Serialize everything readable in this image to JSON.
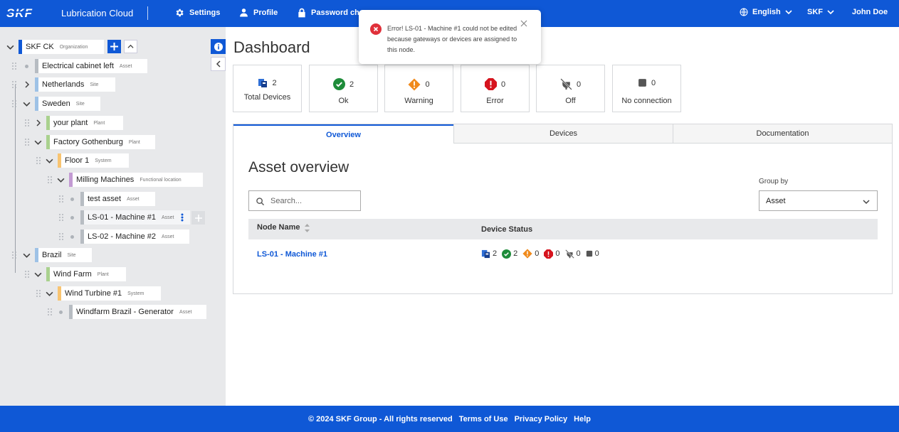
{
  "header": {
    "app_title": "Lubrication Cloud",
    "nav": [
      {
        "label": "Settings",
        "icon": "gear-icon"
      },
      {
        "label": "Profile",
        "icon": "user-icon"
      },
      {
        "label": "Password cha",
        "icon": "lock-icon"
      }
    ],
    "language": "English",
    "org": "SKF",
    "user": "John Doe"
  },
  "toast": {
    "message": "Error! LS-01 - Machine #1 could not be edited because gateways or devices are assigned to this node."
  },
  "tree": [
    {
      "label": "SKF CK",
      "type": "Organization",
      "color": "#0f58d6"
    },
    {
      "label": "Electrical cabinet left",
      "type": "Asset",
      "color": "#b7bcc2"
    },
    {
      "label": "Netherlands",
      "type": "Site",
      "color": "#9ec2e6"
    },
    {
      "label": "Sweden",
      "type": "Site",
      "color": "#9ec2e6"
    },
    {
      "label": "your plant",
      "type": "Plant",
      "color": "#a9d18e"
    },
    {
      "label": "Factory Gothenburg",
      "type": "Plant",
      "color": "#a9d18e"
    },
    {
      "label": "Floor 1",
      "type": "System",
      "color": "#f8c471"
    },
    {
      "label": "Milling Machines",
      "type": "Functional location",
      "color": "#c39bd3"
    },
    {
      "label": "test asset",
      "type": "Asset",
      "color": "#b7bcc2"
    },
    {
      "label": "LS-01 - Machine #1",
      "type": "Asset",
      "color": "#b7bcc2"
    },
    {
      "label": "LS-02 - Machine #2",
      "type": "Asset",
      "color": "#b7bcc2"
    },
    {
      "label": "Brazil",
      "type": "Site",
      "color": "#9ec2e6"
    },
    {
      "label": "Wind Farm",
      "type": "Plant",
      "color": "#a9d18e"
    },
    {
      "label": "Wind Turbine #1",
      "type": "System",
      "color": "#f8c471"
    },
    {
      "label": "Windfarm Brazil - Generator",
      "type": "Asset",
      "color": "#b7bcc2"
    }
  ],
  "dashboard": {
    "title": "Dashboard",
    "cards": [
      {
        "value": "2",
        "label": "Total Devices",
        "icon": "devices-icon"
      },
      {
        "value": "2",
        "label": "Ok",
        "icon": "check-circle-icon"
      },
      {
        "value": "0",
        "label": "Warning",
        "icon": "warning-icon"
      },
      {
        "value": "0",
        "label": "Error",
        "icon": "error-icon"
      },
      {
        "value": "0",
        "label": "Off",
        "icon": "unplugged-icon"
      },
      {
        "value": "0",
        "label": "No connection",
        "icon": "no-connection-icon"
      }
    ],
    "tabs": [
      "Overview",
      "Devices",
      "Documentation"
    ]
  },
  "asset_overview": {
    "title": "Asset overview",
    "search_placeholder": "Search...",
    "group_by_label": "Group by",
    "group_by_value": "Asset",
    "columns": [
      "Node Name",
      "Device Status"
    ],
    "rows": [
      {
        "name": "LS-01 - Machine #1",
        "total": "2",
        "ok": "2",
        "warning": "0",
        "error": "0",
        "off": "0",
        "no_connection": "0"
      }
    ]
  },
  "footer": {
    "copyright": "© 2024 SKF Group - All rights reserved",
    "links": [
      "Terms of Use",
      "Privacy Policy",
      "Help"
    ]
  },
  "colors": {
    "brand": "#0f58d6",
    "ok": "#1e8c3a",
    "warning": "#f08a1c",
    "error": "#d6141e"
  }
}
